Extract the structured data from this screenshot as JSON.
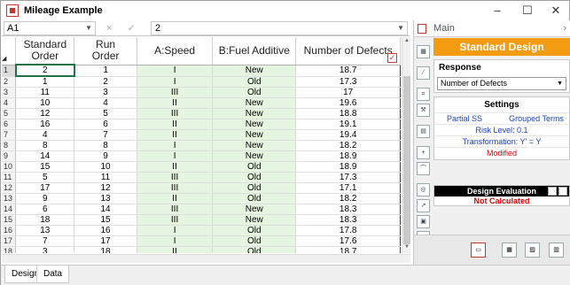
{
  "window": {
    "title": "Mileage Example",
    "min": "–",
    "max": "☐",
    "close": "✕"
  },
  "formula_bar": {
    "cell_ref": "A1",
    "value": "2",
    "cancel": "×",
    "accept": "✓"
  },
  "table": {
    "headers": [
      "Standard Order",
      "Run Order",
      "A:Speed",
      "B:Fuel Additive",
      "Number of Defects"
    ],
    "rows": [
      [
        "1",
        "2",
        "1",
        "I",
        "New",
        "18.7"
      ],
      [
        "2",
        "1",
        "2",
        "I",
        "Old",
        "17.3"
      ],
      [
        "3",
        "11",
        "3",
        "III",
        "Old",
        "17"
      ],
      [
        "4",
        "10",
        "4",
        "II",
        "New",
        "19.6"
      ],
      [
        "5",
        "12",
        "5",
        "III",
        "New",
        "18.8"
      ],
      [
        "6",
        "16",
        "6",
        "II",
        "New",
        "19.1"
      ],
      [
        "7",
        "4",
        "7",
        "II",
        "New",
        "19.4"
      ],
      [
        "8",
        "8",
        "8",
        "I",
        "New",
        "18.2"
      ],
      [
        "9",
        "14",
        "9",
        "I",
        "New",
        "18.9"
      ],
      [
        "10",
        "15",
        "10",
        "II",
        "Old",
        "18.9"
      ],
      [
        "11",
        "5",
        "11",
        "III",
        "Old",
        "17.3"
      ],
      [
        "12",
        "17",
        "12",
        "III",
        "Old",
        "17.1"
      ],
      [
        "13",
        "9",
        "13",
        "II",
        "Old",
        "18.2"
      ],
      [
        "14",
        "6",
        "14",
        "III",
        "New",
        "18.3"
      ],
      [
        "15",
        "18",
        "15",
        "III",
        "New",
        "18.3"
      ],
      [
        "16",
        "13",
        "16",
        "I",
        "Old",
        "17.8"
      ],
      [
        "17",
        "7",
        "17",
        "I",
        "Old",
        "17.6"
      ],
      [
        "18",
        "3",
        "18",
        "II",
        "Old",
        "18.7"
      ]
    ]
  },
  "sheet_tabs": [
    "Design",
    "Data"
  ],
  "side": {
    "header": "Main",
    "banner": "Standard Design",
    "response_label": "Response",
    "response_value": "Number of Defects",
    "settings_label": "Settings",
    "settings_partial": "Partial SS",
    "settings_grouped": "Grouped Terms",
    "risk": "Risk Level: 0.1",
    "transform": "Transformation: Y' = Y",
    "modified": "Modified",
    "eval_label": "Design Evaluation",
    "eval_status": "Not Calculated"
  },
  "colors": {
    "accent": "#f39c12",
    "factor_bg": "#e6f5e0",
    "response_border": "#2b3aa6",
    "error": "#e00000"
  }
}
